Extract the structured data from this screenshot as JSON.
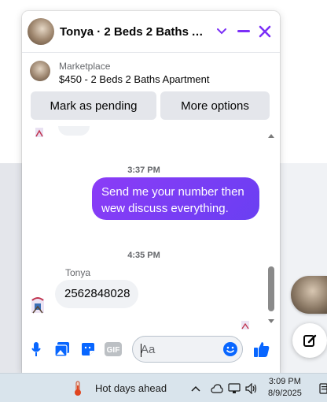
{
  "chat": {
    "title": "Tonya · 2 Beds 2 Baths Apartment",
    "listing": {
      "label": "Marketplace",
      "title": "$450 - 2 Beds 2 Baths Apartment"
    },
    "actions": {
      "mark_pending": "Mark as pending",
      "more_options": "More options"
    },
    "messages": [
      {
        "type": "timestamp",
        "text": "3:37 PM"
      },
      {
        "type": "outgoing",
        "text": "Send me your number then wew discuss everything."
      },
      {
        "type": "timestamp",
        "text": "4:35 PM"
      },
      {
        "type": "incoming",
        "sender": "Tonya",
        "text": "2562848028"
      }
    ],
    "composer": {
      "placeholder": "Aa"
    }
  },
  "taskbar": {
    "weather": "Hot days ahead",
    "time": "3:09 PM",
    "date": "8/9/2025"
  },
  "colors": {
    "accent": "#7b2ff7",
    "outgoing_bubble": "#7a3df4",
    "incoming_bubble": "#f0f2f5",
    "messenger_blue": "#0866ff"
  }
}
